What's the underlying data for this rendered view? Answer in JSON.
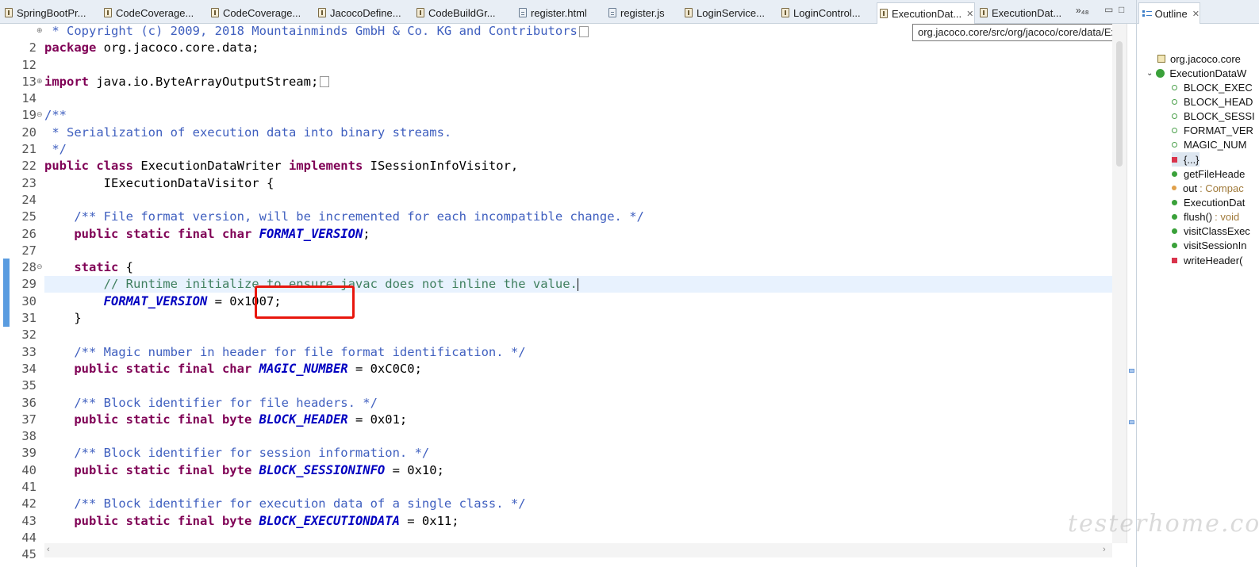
{
  "tabs": [
    {
      "label": "SpringBootPr...",
      "icon": "java-file-icon"
    },
    {
      "label": "CodeCoverage...",
      "icon": "java-file-icon"
    },
    {
      "label": "CodeCoverage...",
      "icon": "java-file-icon"
    },
    {
      "label": "JacocoDefine...",
      "icon": "java-file-icon"
    },
    {
      "label": "CodeBuildGr...",
      "icon": "java-file-icon"
    },
    {
      "label": "register.html",
      "icon": "html-file-icon"
    },
    {
      "label": "register.js",
      "icon": "js-file-icon"
    },
    {
      "label": "LoginService...",
      "icon": "java-file-icon"
    },
    {
      "label": "LoginControl...",
      "icon": "java-file-icon"
    },
    {
      "label": "ExecutionDat...",
      "icon": "java-file-icon",
      "active": true
    },
    {
      "label": "ExecutionDat...",
      "icon": "java-file-icon"
    }
  ],
  "tab_overflow": "»₄₈",
  "outline_tab": {
    "label": "Outline"
  },
  "tooltip": "org.jacoco.core/src/org/jacoco/core/data/ExecutionDataWriter.java",
  "code": {
    "l2": " * Copyright (c) 2009, 2018 Mountainminds GmbH & Co. KG and Contributors",
    "l12_kw": "package",
    "l12_rest": " org.jacoco.core.data;",
    "l14_kw": "import",
    "l14_rest": " java.io.ByteArrayOutputStream;",
    "l20": "/**",
    "l21": " * Serialization of execution data into binary streams.",
    "l22": " */",
    "l23_kw1": "public class",
    "l23_mid": " ExecutionDataWriter ",
    "l23_kw2": "implements",
    "l23_rest": " ISessionInfoVisitor,",
    "l24": "        IExecutionDataVisitor {",
    "l26": "    /** File format version, will be incremented for each incompatible change. */",
    "l27_kw": "    public static final char ",
    "l27_fi": "FORMAT_VERSION",
    "l27_rest": ";",
    "l29_kw": "    static",
    "l29_rest": " {",
    "l30": "        // Runtime initialize to ensure javac does not inline the value.",
    "l31_fi": "FORMAT_VERSION",
    "l31_rest": " = 0x1007;",
    "l32": "    }",
    "l34": "    /** Magic number in header for file format identification. */",
    "l35_kw": "    public static final char ",
    "l35_fi": "MAGIC_NUMBER",
    "l35_rest": " = 0xC0C0;",
    "l37": "    /** Block identifier for file headers. */",
    "l38_kw": "    public static final byte ",
    "l38_fi": "BLOCK_HEADER",
    "l38_rest": " = 0x01;",
    "l40": "    /** Block identifier for session information. */",
    "l41_kw": "    public static final byte ",
    "l41_fi": "BLOCK_SESSIONINFO",
    "l41_rest": " = 0x10;",
    "l43": "    /** Block identifier for execution data of a single class. */",
    "l44_kw": "    public static final byte ",
    "l44_fi": "BLOCK_EXECUTIONDATA",
    "l44_rest": " = 0x11;"
  },
  "line_numbers": [
    "2",
    "12",
    "13",
    "14",
    "19",
    "20",
    "21",
    "22",
    "23",
    "24",
    "25",
    "26",
    "27",
    "28",
    "29",
    "30",
    "31",
    "32",
    "33",
    "34",
    "35",
    "36",
    "37",
    "38",
    "39",
    "40",
    "41",
    "42",
    "43",
    "44",
    "45"
  ],
  "outline": [
    {
      "label": "org.jacoco.core",
      "symbol": "package-icon"
    },
    {
      "label": "ExecutionDataW",
      "symbol": "class-icon"
    },
    {
      "label": "BLOCK_EXEC",
      "symbol": "static-field-icon"
    },
    {
      "label": "BLOCK_HEAD",
      "symbol": "static-field-icon"
    },
    {
      "label": "BLOCK_SESSI",
      "symbol": "static-field-icon"
    },
    {
      "label": "FORMAT_VER",
      "symbol": "static-field-icon"
    },
    {
      "label": "MAGIC_NUM",
      "symbol": "static-field-icon"
    },
    {
      "label": "{...}",
      "symbol": "static-initializer-icon"
    },
    {
      "label": "getFileHeade",
      "symbol": "public-method-icon"
    },
    {
      "label": "out",
      "type": " : Compac",
      "symbol": "protected-field-icon"
    },
    {
      "label": "ExecutionDat",
      "symbol": "constructor-icon"
    },
    {
      "label": "flush()",
      "type": " : void",
      "symbol": "public-method-icon"
    },
    {
      "label": "visitClassExec",
      "symbol": "public-method-icon"
    },
    {
      "label": "visitSessionIn",
      "symbol": "public-method-icon"
    },
    {
      "label": "writeHeader(",
      "symbol": "private-method-icon"
    }
  ],
  "watermark": "testerhome.com",
  "colors": {
    "keyword": "#7f0055",
    "comment": "#3f5fbf",
    "line_comment": "#3f7f5f",
    "field": "#0000c0",
    "annotation_box": "#e8160d"
  }
}
